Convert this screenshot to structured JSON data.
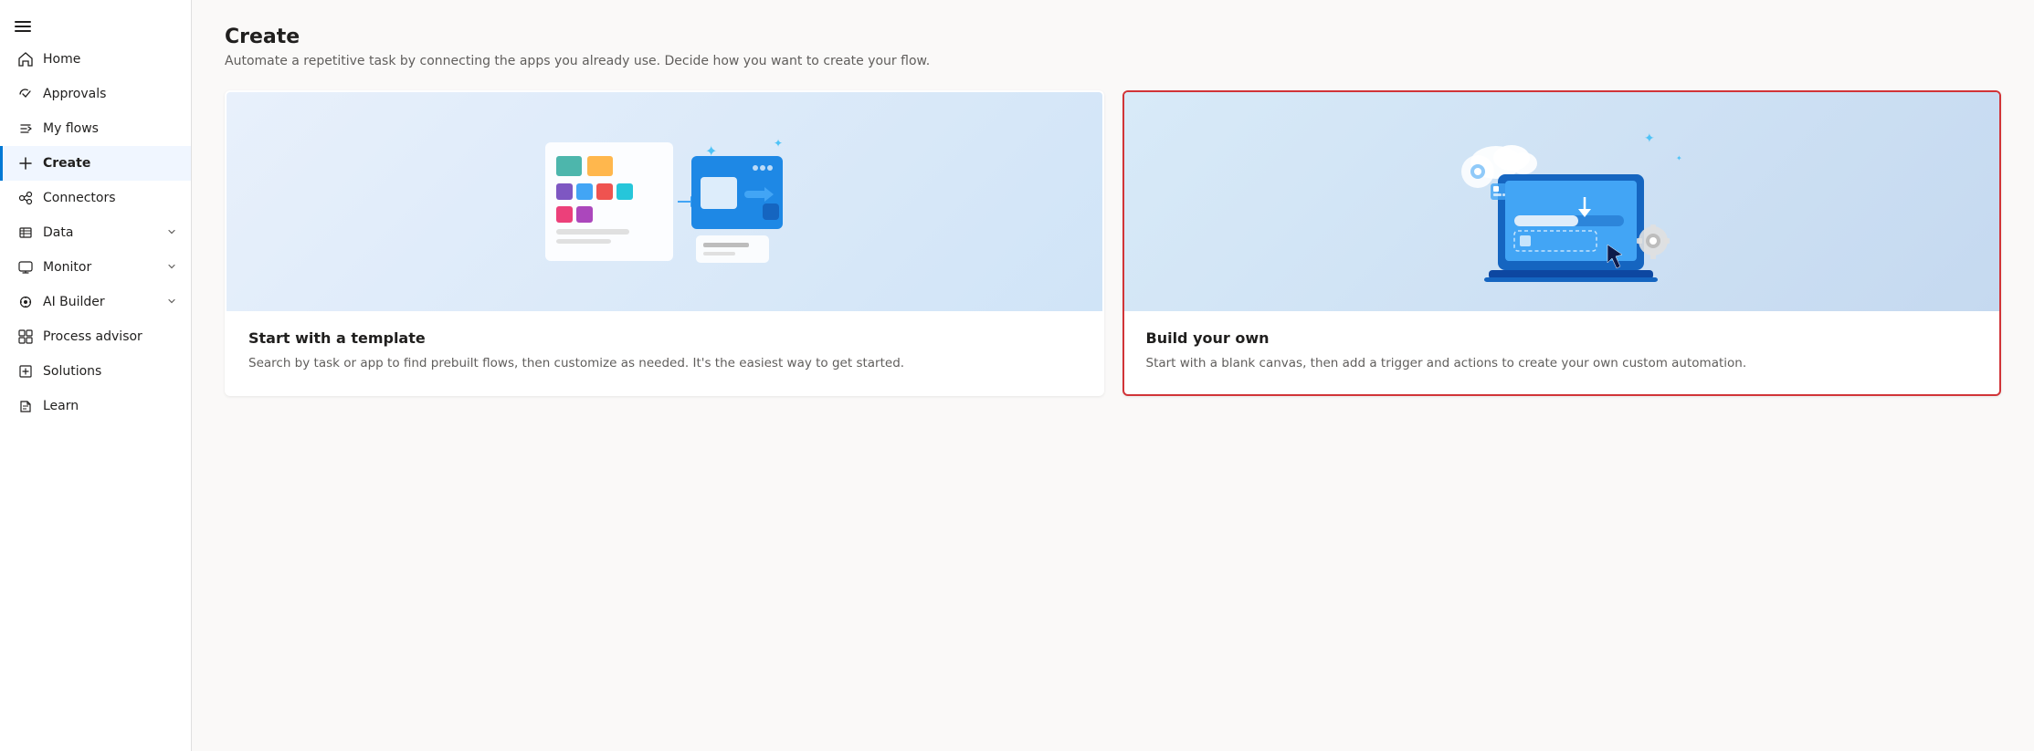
{
  "sidebar": {
    "hamburger_label": "Menu",
    "items": [
      {
        "id": "home",
        "label": "Home",
        "icon": "home",
        "active": false,
        "hasChevron": false
      },
      {
        "id": "approvals",
        "label": "Approvals",
        "icon": "approvals",
        "active": false,
        "hasChevron": false
      },
      {
        "id": "my-flows",
        "label": "My flows",
        "icon": "flows",
        "active": false,
        "hasChevron": false
      },
      {
        "id": "create",
        "label": "Create",
        "icon": "create",
        "active": true,
        "hasChevron": false
      },
      {
        "id": "connectors",
        "label": "Connectors",
        "icon": "connectors",
        "active": false,
        "hasChevron": false
      },
      {
        "id": "data",
        "label": "Data",
        "icon": "data",
        "active": false,
        "hasChevron": true
      },
      {
        "id": "monitor",
        "label": "Monitor",
        "icon": "monitor",
        "active": false,
        "hasChevron": true
      },
      {
        "id": "ai-builder",
        "label": "AI Builder",
        "icon": "ai-builder",
        "active": false,
        "hasChevron": true
      },
      {
        "id": "process-advisor",
        "label": "Process advisor",
        "icon": "process-advisor",
        "active": false,
        "hasChevron": false
      },
      {
        "id": "solutions",
        "label": "Solutions",
        "icon": "solutions",
        "active": false,
        "hasChevron": false
      },
      {
        "id": "learn",
        "label": "Learn",
        "icon": "learn",
        "active": false,
        "hasChevron": false
      }
    ]
  },
  "main": {
    "title": "Create",
    "subtitle": "Automate a repetitive task by connecting the apps you already use. Decide how you want to create your flow.",
    "cards": [
      {
        "id": "template",
        "title": "Start with a template",
        "desc": "Search by task or app to find prebuilt flows, then customize as needed. It's the easiest way to get started.",
        "selected": false
      },
      {
        "id": "build-own",
        "title": "Build your own",
        "desc": "Start with a blank canvas, then add a trigger and actions to create your own custom automation.",
        "selected": true
      }
    ]
  },
  "icons": {
    "home": "⌂",
    "approvals": "✓",
    "flows": "∿",
    "create": "+",
    "connectors": "⬡",
    "data": "▤",
    "monitor": "□",
    "ai-builder": "◎",
    "process-advisor": "⊞",
    "solutions": "⊟",
    "learn": "📖"
  }
}
